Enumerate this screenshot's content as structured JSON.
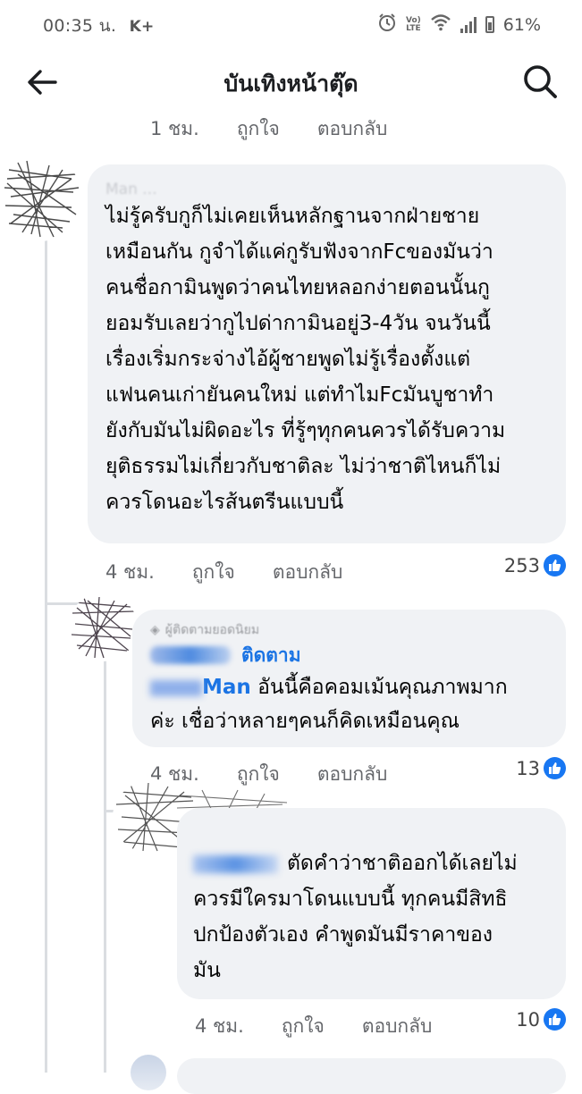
{
  "status_bar": {
    "time": "00:35 น.",
    "carrier": "K+",
    "volte": "Vo) LTE",
    "battery": "61%"
  },
  "header": {
    "title": "บันเทิงหน้าตุ๊ด"
  },
  "top_meta": {
    "time": "1 ชม.",
    "like": "ถูกใจ",
    "reply": "ตอบกลับ"
  },
  "comments": [
    {
      "author": "Man ...",
      "text": "ไม่รู้ครับกูก็ไม่เคยเห็นหลักฐานจากฝ่ายชาย เหมือนกัน กูจำได้แค่กูรับฟังจากFcของมันว่า คนชื่อกามินพูดว่าคนไทยหลอกง่ายตอนนั้นกู ยอมรับเลยว่ากูไปด่ากามินอยู่3-4วัน จนวันนี้ เรื่องเริ่มกระจ่างไอ้ผู้ชายพูดไม่รู้เรื่องตั้งแต่ แฟนคนเก่ายันคนใหม่ แต่ทำไมFcมันบูชาทำ ยังกับมันไม่ผิดอะไร ที่รู้ๆทุกคนควรได้รับความ ยุติธรรมไม่เกี่ยวกับชาติละ ไม่ว่าชาติไหนก็ไม่ ควรโดนอะไรส้นตรีนแบบนี้",
      "lines": [
        "ไม่รู้ครับกูก็ไม่เคยเห็นหลักฐานจากฝ่ายชาย",
        "เหมือนกัน กูจำได้แค่กูรับฟังจากFcของมันว่า",
        "คนชื่อกามินพูดว่าคนไทยหลอกง่ายตอนนั้นกู",
        "ยอมรับเลยว่ากูไปด่ากามินอยู่3-4วัน จนวันนี้",
        "เรื่องเริ่มกระจ่างไอ้ผู้ชายพูดไม่รู้เรื่องตั้งแต่",
        "แฟนคนเก่ายันคนใหม่ แต่ทำไมFcมันบูชาทำ",
        "ยังกับมันไม่ผิดอะไร ที่รู้ๆทุกคนควรได้รับความ",
        "ยุติธรรมไม่เกี่ยวกับชาติละ ไม่ว่าชาติไหนก็ไม่",
        "ควรโดนอะไรส้นตรีนแบบนี้"
      ],
      "time": "4 ชม.",
      "like": "ถูกใจ",
      "reply": "ตอบกลับ",
      "reactions": "253"
    },
    {
      "badge": "ผู้ติดตามยอดนิยม",
      "author": "...",
      "follow": "ติดตาม",
      "mention": "Man",
      "line1_rest": "อันนี้คือคอมเม้นคุณภาพมาก",
      "line2": "ค่ะ เชื่อว่าหลายๆคนก็คิดเหมือนคุณ",
      "time": "4 ชม.",
      "like": "ถูกใจ",
      "reply": "ตอบกลับ",
      "reactions": "13"
    },
    {
      "author": "...",
      "line1_rest": "ตัดคำว่าชาติออกได้เลยไม่",
      "line2": "ควรมีใครมาโดนแบบนี้ ทุกคนมีสิทธิ",
      "line3": "ปกป้องตัวเอง คำพูดมันมีราคาของ",
      "line4": "มัน",
      "time": "4 ชม.",
      "like": "ถูกใจ",
      "reply": "ตอบกลับ",
      "reactions": "10"
    }
  ],
  "colors": {
    "bubble": "#f0f2f5",
    "link": "#1b74e4",
    "like_blue": "#1877f2",
    "meta": "#65676b"
  }
}
